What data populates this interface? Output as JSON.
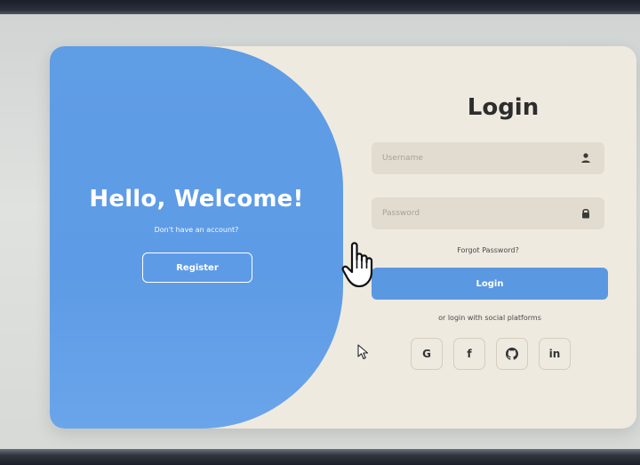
{
  "welcome": {
    "title": "Hello, Welcome!",
    "subtitle": "Don't have an account?",
    "register_label": "Register"
  },
  "login": {
    "title": "Login",
    "username_placeholder": "Username",
    "password_placeholder": "Password",
    "forgot_label": "Forgot Password?",
    "login_label": "Login",
    "social_text": "or login with social platforms",
    "social": [
      {
        "label": "G",
        "icon": "google-icon"
      },
      {
        "label": "f",
        "icon": "facebook-icon"
      },
      {
        "label": "",
        "icon": "github-icon"
      },
      {
        "label": "in",
        "icon": "linkedin-icon"
      }
    ]
  },
  "colors": {
    "accent": "#5f9de5",
    "card_background": "#efeae0",
    "input_background": "#e2dcd0"
  }
}
